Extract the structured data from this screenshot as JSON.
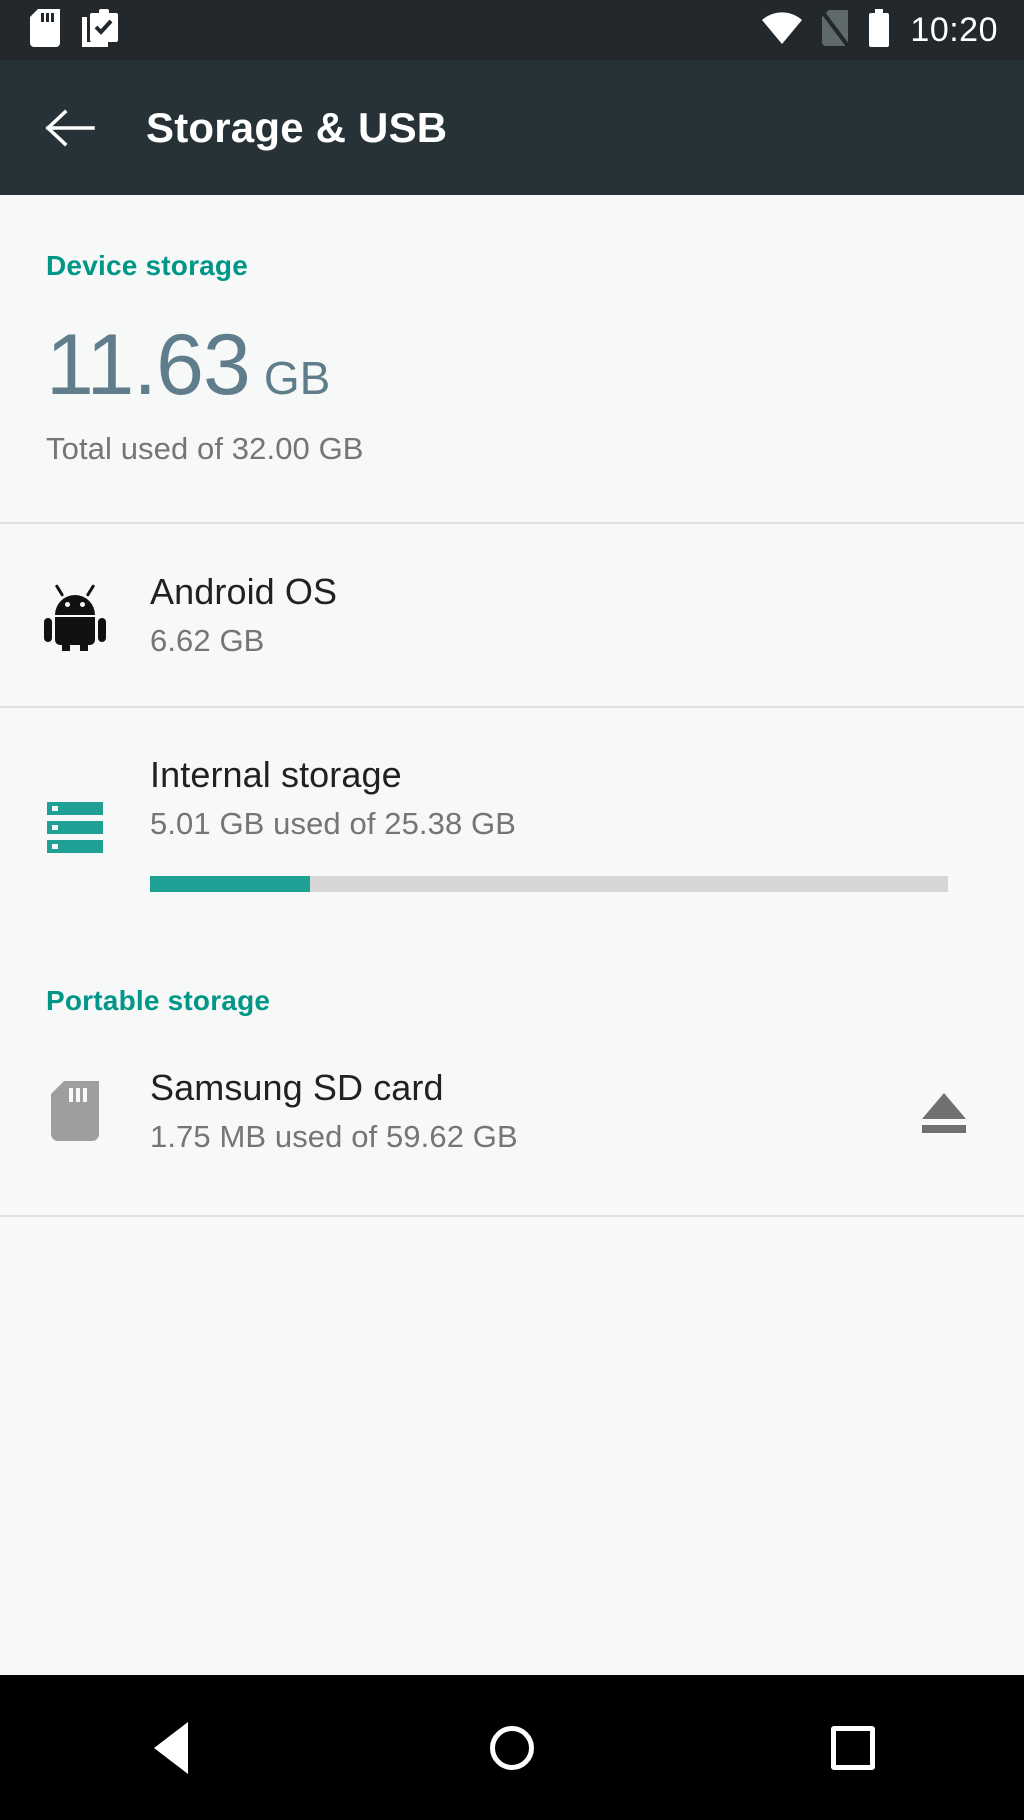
{
  "status_bar": {
    "icons_left": [
      "sd-card-icon",
      "clipboard-check-icon"
    ],
    "icons_right": [
      "wifi-icon",
      "no-sim-icon",
      "battery-full-icon"
    ],
    "time": "10:20",
    "background": "#22282b"
  },
  "app_bar": {
    "back_icon": "back-arrow-icon",
    "title": "Storage & USB",
    "background": "#263238"
  },
  "device_storage": {
    "section_label": "Device storage",
    "total_used_amount": "11.63",
    "total_used_unit": "GB",
    "total_used_caption": "Total used of 32.00 GB",
    "items": [
      {
        "icon": "android-robot-icon",
        "title": "Android OS",
        "subtitle": "6.62 GB",
        "has_progress": false
      },
      {
        "icon": "internal-storage-icon",
        "title": "Internal storage",
        "subtitle": "5.01 GB used of 25.38 GB",
        "has_progress": true,
        "progress_percent": 20
      }
    ]
  },
  "portable_storage": {
    "section_label": "Portable storage",
    "items": [
      {
        "icon": "sd-card-icon",
        "title": "Samsung SD card",
        "subtitle": "1.75 MB used of 59.62 GB",
        "action_icon": "eject-icon"
      }
    ]
  },
  "nav_bar": {
    "back": "nav-back-icon",
    "home": "nav-home-icon",
    "recents": "nav-recents-icon",
    "background": "#000000"
  },
  "colors": {
    "accent_teal": "#009688",
    "progress_teal": "#21a195",
    "summary_slate": "#607d8b",
    "secondary_text": "#757575",
    "primary_text": "#212121",
    "page_background": "#f7f8f8"
  }
}
